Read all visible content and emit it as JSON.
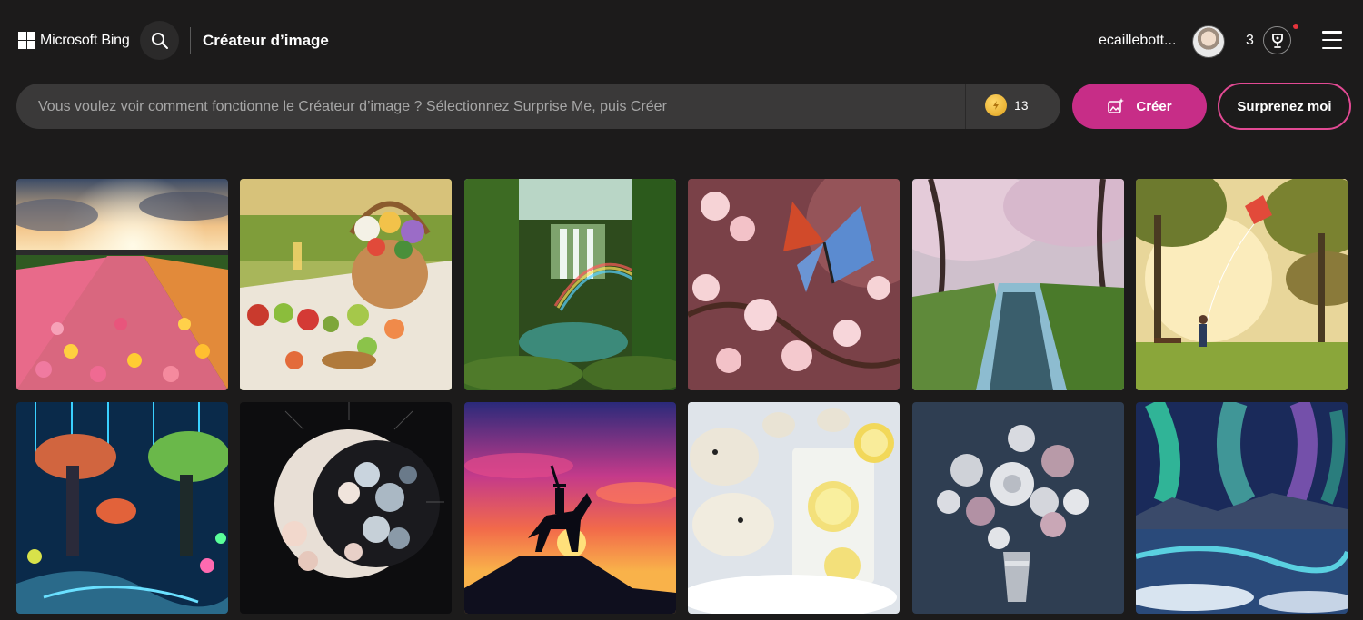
{
  "header": {
    "brand": "Microsoft Bing",
    "title": "Créateur d’image",
    "username": "ecaillebott...",
    "rewards_count": "3",
    "icons": {
      "search": "search-icon",
      "trophy": "trophy-icon",
      "menu": "hamburger-menu-icon"
    }
  },
  "prompt": {
    "placeholder": "Vous voulez voir comment fonctionne le Créateur d’image ? Sélectionnez Surprise Me, puis Créer",
    "value": "",
    "boosts": "13"
  },
  "actions": {
    "create_label": "Créer",
    "surprise_label": "Surprenez moi"
  },
  "colors": {
    "background": "#1c1b1b",
    "prompt_bg": "#3a3939",
    "accent": "#c72d87",
    "accent_border": "#e24a94",
    "notification": "#e5343c"
  },
  "gallery": [
    {
      "subject": "tulip-field-sunset"
    },
    {
      "subject": "picnic-basket-flowers-fruit"
    },
    {
      "subject": "jungle-waterfall-rainbow"
    },
    {
      "subject": "butterfly-cherry-blossoms"
    },
    {
      "subject": "cherry-blossom-path-river"
    },
    {
      "subject": "park-kite-children"
    },
    {
      "subject": "digital-glowing-forest"
    },
    {
      "subject": "crescent-moon-flowers"
    },
    {
      "subject": "cowboy-horse-sunset-silhouette"
    },
    {
      "subject": "polar-bears-lemonade"
    },
    {
      "subject": "silver-flower-bouquet"
    },
    {
      "subject": "aurora-frozen-landscape"
    }
  ]
}
